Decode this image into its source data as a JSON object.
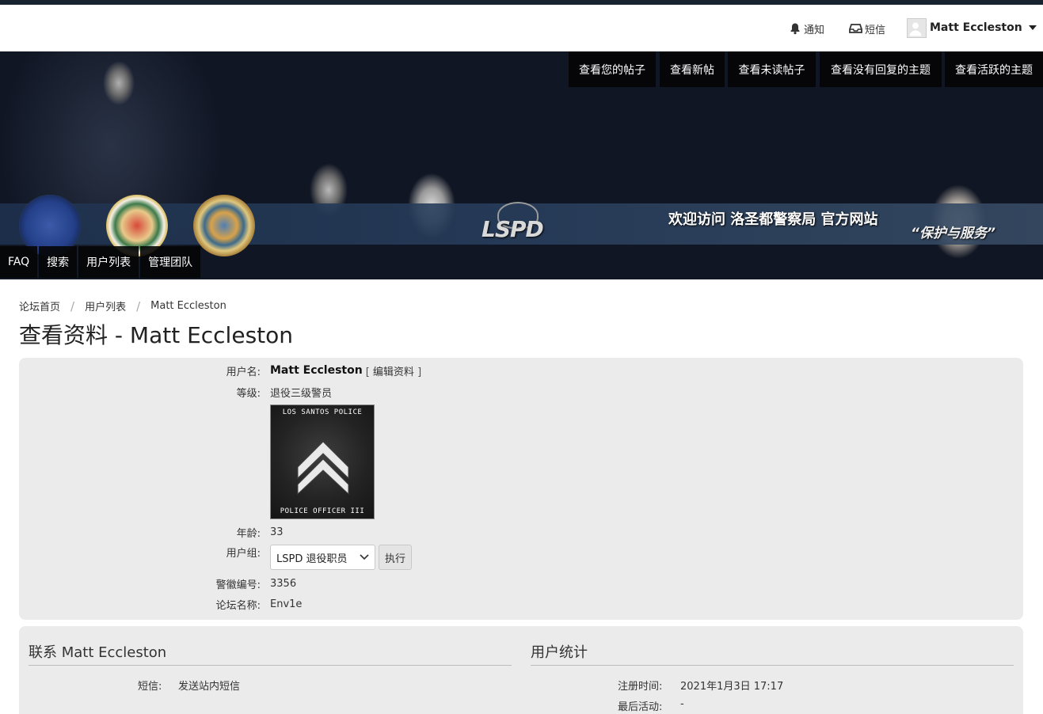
{
  "userbar": {
    "notifications": "通知",
    "messages": "短信",
    "username": "Matt Eccleston"
  },
  "banner": {
    "welcome": "欢迎访问 洛圣都警察局 官方网站",
    "motto": "“保护与服务”",
    "logo": "LSPD"
  },
  "nav_top": [
    "查看您的帖子",
    "查看新帖",
    "查看未读帖子",
    "查看没有回复的主题",
    "查看活跃的主题"
  ],
  "nav_bottom": [
    "FAQ",
    "搜索",
    "用户列表",
    "管理团队"
  ],
  "breadcrumb": [
    "论坛首页",
    "用户列表",
    "Matt Eccleston"
  ],
  "page_title": "查看资料 - Matt Eccleston",
  "profile": {
    "username_label": "用户名:",
    "username": "Matt Eccleston",
    "edit_open": "[",
    "edit_link": "编辑资料",
    "edit_close": "]",
    "rank_label": "等级:",
    "rank": "退役三级警员",
    "rank_image_top": "LOS SANTOS POLICE",
    "rank_image_bottom": "POLICE OFFICER III",
    "age_label": "年龄:",
    "age": "33",
    "group_label": "用户组:",
    "group_selected": "LSPD 退役职员",
    "execute_button": "执行",
    "badge_label": "警徽编号:",
    "badge_number": "3356",
    "forum_name_label": "论坛名称:",
    "forum_name": "Env1e"
  },
  "contact": {
    "title": "联系 Matt Eccleston",
    "pm_label": "短信:",
    "pm_link": "发送站内短信"
  },
  "stats": {
    "title": "用户统计",
    "joined_label": "注册时间:",
    "joined": "2021年1月3日 17:17",
    "last_active_label": "最后活动:",
    "last_active": "-"
  }
}
